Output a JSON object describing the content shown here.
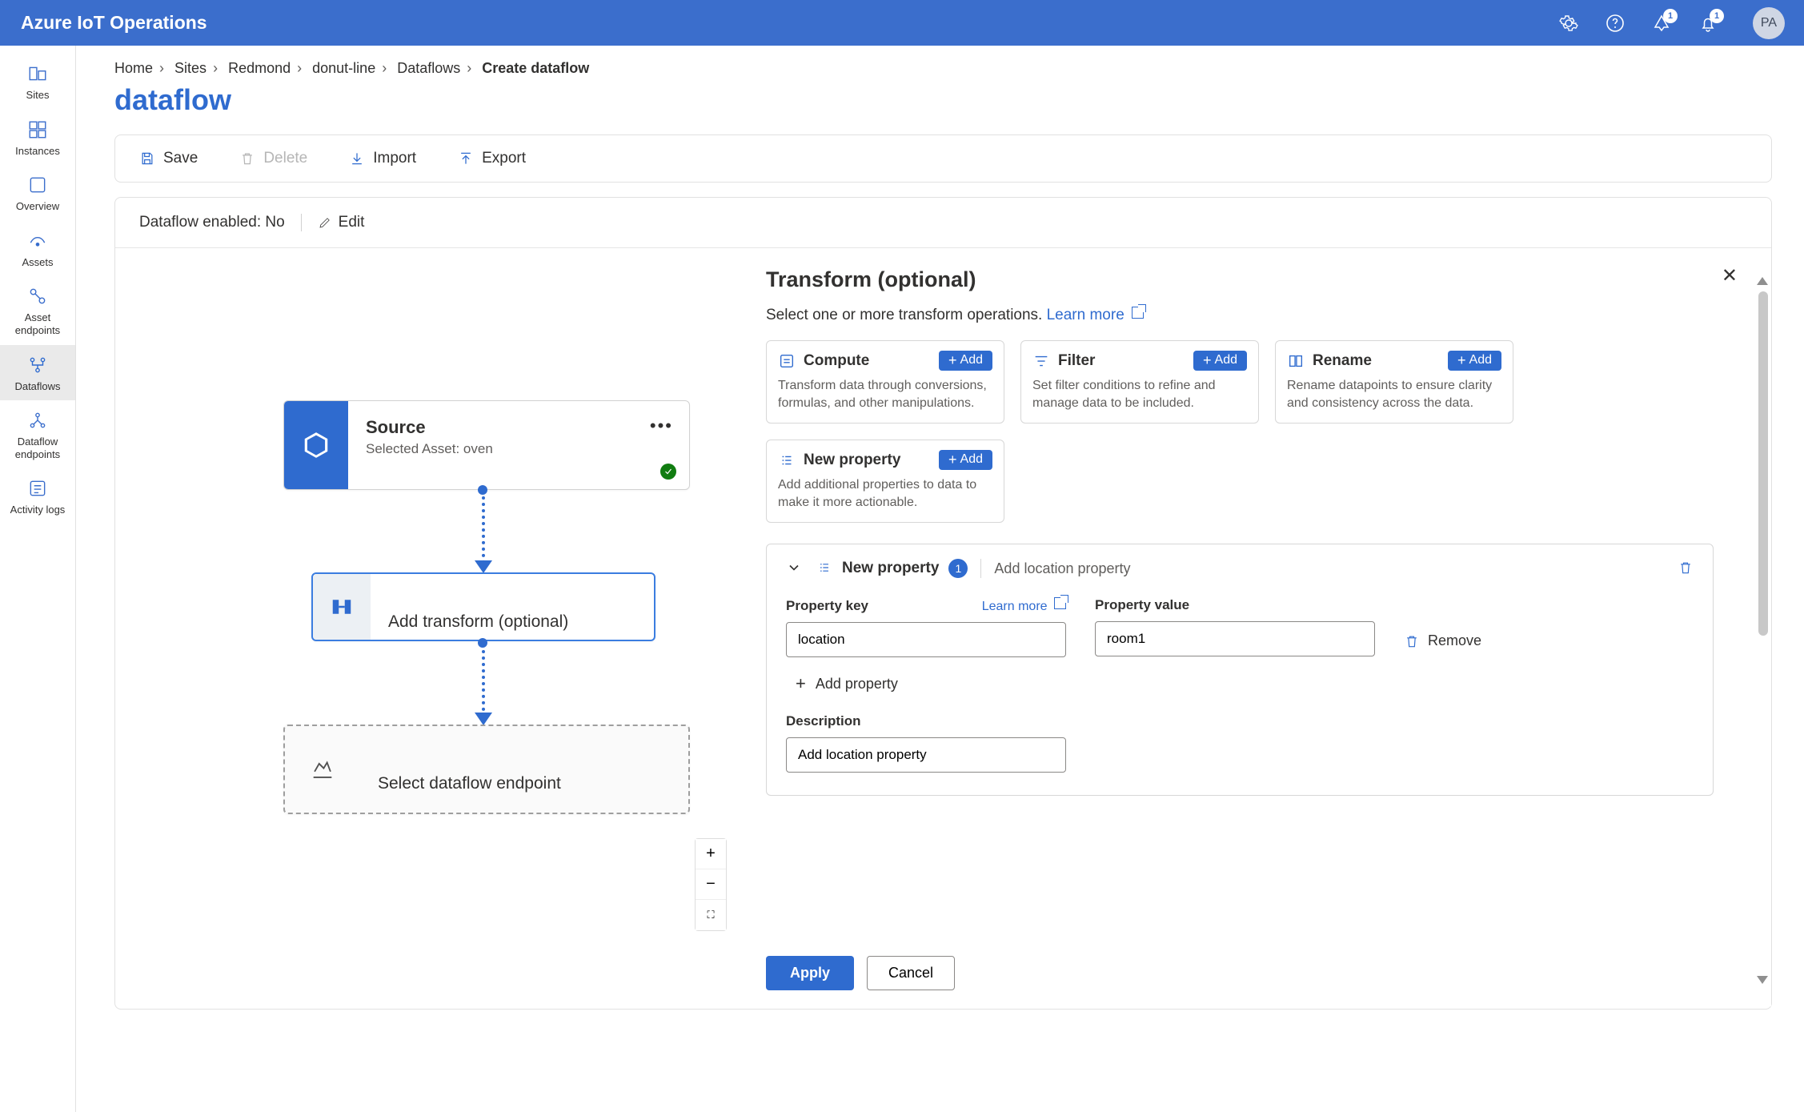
{
  "app": {
    "title": "Azure IoT Operations"
  },
  "topbar": {
    "alerts_badge": "1",
    "notif_badge": "1",
    "avatar_initials": "PA"
  },
  "nav": {
    "items": [
      {
        "label": "Sites"
      },
      {
        "label": "Instances"
      },
      {
        "label": "Overview"
      },
      {
        "label": "Assets"
      },
      {
        "label": "Asset endpoints"
      },
      {
        "label": "Dataflows"
      },
      {
        "label": "Dataflow endpoints"
      },
      {
        "label": "Activity logs"
      }
    ]
  },
  "breadcrumbs": {
    "items": [
      "Home",
      "Sites",
      "Redmond",
      "donut-line",
      "Dataflows"
    ],
    "current": "Create dataflow"
  },
  "page": {
    "title": "dataflow"
  },
  "toolbar": {
    "save": "Save",
    "delete": "Delete",
    "import": "Import",
    "export": "Export"
  },
  "status": {
    "label": "Dataflow enabled: No",
    "edit": "Edit"
  },
  "graph": {
    "source": {
      "title": "Source",
      "subtitle": "Selected Asset: oven"
    },
    "transform": {
      "title": "Add transform (optional)"
    },
    "endpoint": {
      "title": "Select dataflow endpoint"
    }
  },
  "panel": {
    "title": "Transform (optional)",
    "subtitle_prefix": "Select one or more transform operations. ",
    "learn_more": "Learn more",
    "close": "✕",
    "cards": [
      {
        "name": "Compute",
        "desc": "Transform data through conversions, formulas, and other manipulations.",
        "add": "Add"
      },
      {
        "name": "Filter",
        "desc": "Set filter conditions to refine and manage data to be included.",
        "add": "Add"
      },
      {
        "name": "Rename",
        "desc": "Rename datapoints to ensure clarity and consistency across the data.",
        "add": "Add"
      },
      {
        "name": "New property",
        "desc": "Add additional properties to data to make it more actionable.",
        "add": "Add"
      }
    ],
    "prop_section": {
      "heading": "New property",
      "count": "1",
      "row_desc": "Add location property",
      "key_label": "Property key",
      "key_learn_more": "Learn more",
      "key_value": "location",
      "val_label": "Property value",
      "val_value": "room1",
      "remove": "Remove",
      "add_property": "Add property",
      "description_label": "Description",
      "description_value": "Add location property"
    },
    "apply": "Apply",
    "cancel": "Cancel"
  }
}
